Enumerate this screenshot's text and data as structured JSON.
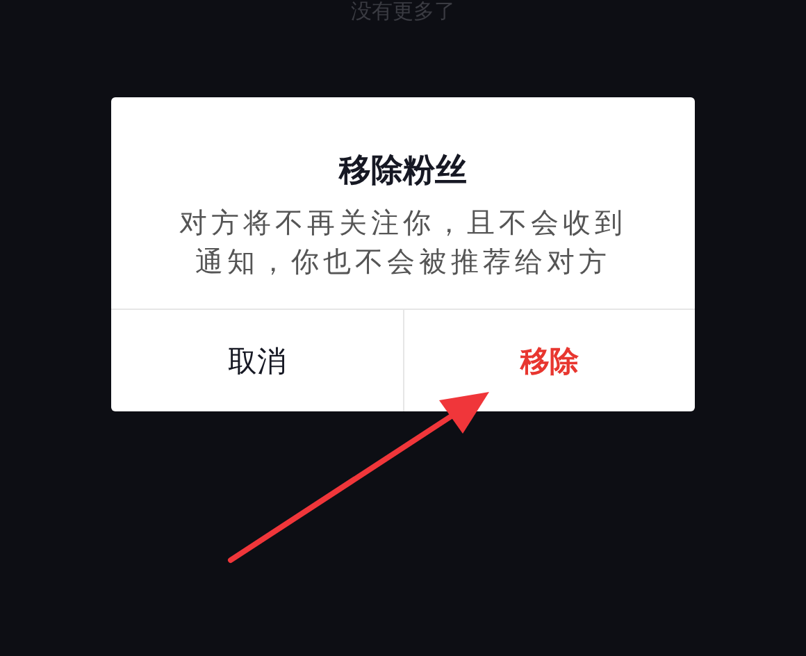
{
  "list_end_text": "没有更多了",
  "dialog": {
    "title": "移除粉丝",
    "message": "对方将不再关注你，且不会收到通知，你也不会被推荐给对方",
    "buttons": [
      {
        "label": "取消",
        "kind": "cancel"
      },
      {
        "label": "移除",
        "kind": "destructive"
      }
    ]
  }
}
